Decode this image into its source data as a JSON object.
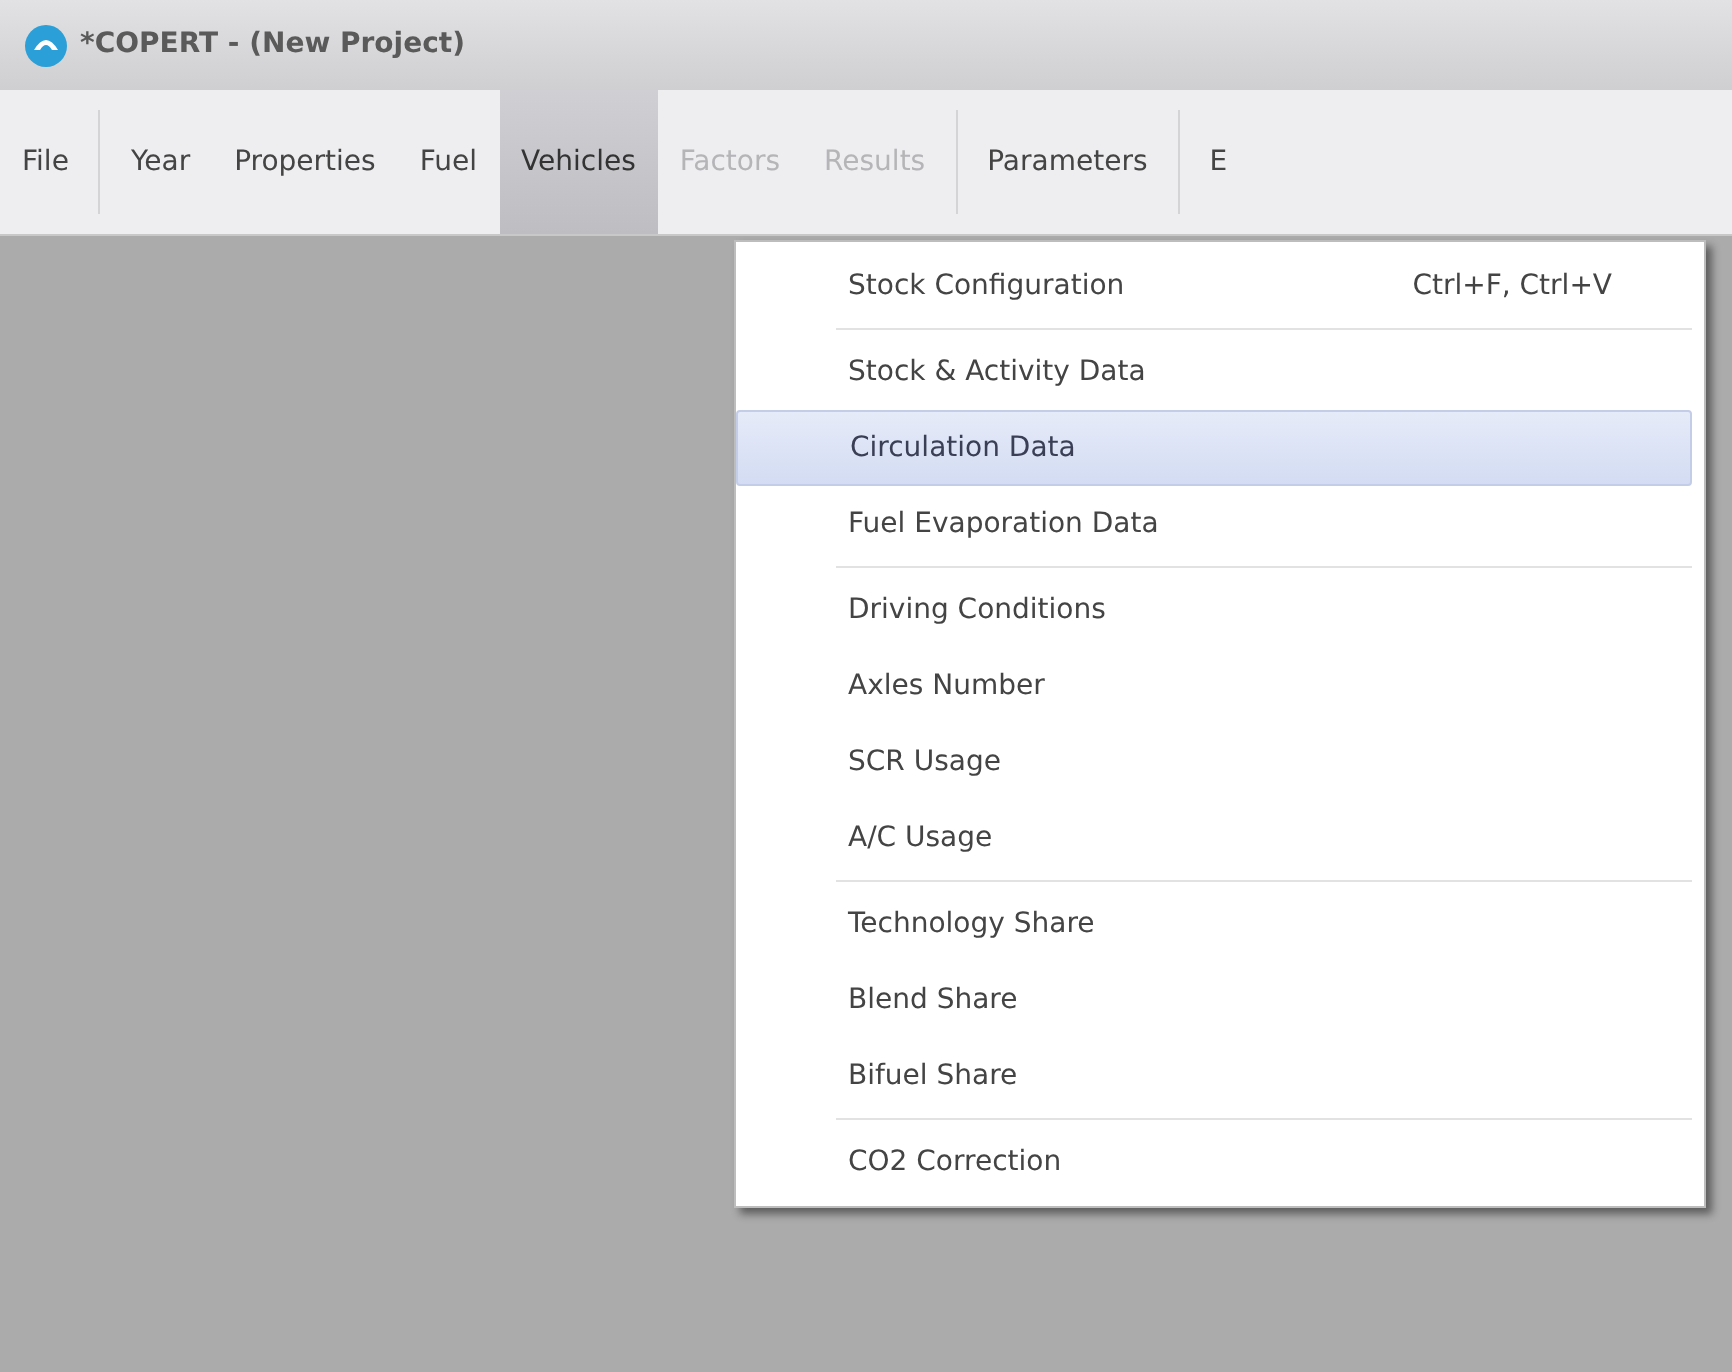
{
  "window": {
    "title": "*COPERT -  (New Project)"
  },
  "menu_bar": [
    {
      "label": "File",
      "selected": false,
      "disabled": false,
      "separator_after": true
    },
    {
      "label": "Year",
      "selected": false,
      "disabled": false,
      "separator_after": false
    },
    {
      "label": "Properties",
      "selected": false,
      "disabled": false,
      "separator_after": false
    },
    {
      "label": "Fuel",
      "selected": false,
      "disabled": false,
      "separator_after": false
    },
    {
      "label": "Vehicles",
      "selected": true,
      "disabled": false,
      "separator_after": false
    },
    {
      "label": "Factors",
      "selected": false,
      "disabled": true,
      "separator_after": false
    },
    {
      "label": "Results",
      "selected": false,
      "disabled": true,
      "separator_after": true
    },
    {
      "label": "Parameters",
      "selected": false,
      "disabled": false,
      "separator_after": true
    },
    {
      "label": "E",
      "selected": false,
      "disabled": false,
      "separator_after": false
    }
  ],
  "dropdown": {
    "groups": [
      {
        "items": [
          {
            "label": "Stock Configuration",
            "shortcut": "Ctrl+F, Ctrl+V",
            "selected": false
          }
        ]
      },
      {
        "items": [
          {
            "label": "Stock & Activity Data",
            "selected": false
          },
          {
            "label": "Circulation Data",
            "selected": true
          },
          {
            "label": "Fuel Evaporation Data",
            "selected": false
          }
        ]
      },
      {
        "items": [
          {
            "label": "Driving Conditions",
            "selected": false
          },
          {
            "label": "Axles Number",
            "selected": false
          },
          {
            "label": "SCR Usage",
            "selected": false
          },
          {
            "label": "A/C Usage",
            "selected": false
          }
        ]
      },
      {
        "items": [
          {
            "label": "Technology Share",
            "selected": false
          },
          {
            "label": "Blend Share",
            "selected": false
          },
          {
            "label": "Bifuel Share",
            "selected": false
          }
        ]
      },
      {
        "items": [
          {
            "label": "CO2 Correction",
            "selected": false
          }
        ]
      }
    ]
  }
}
